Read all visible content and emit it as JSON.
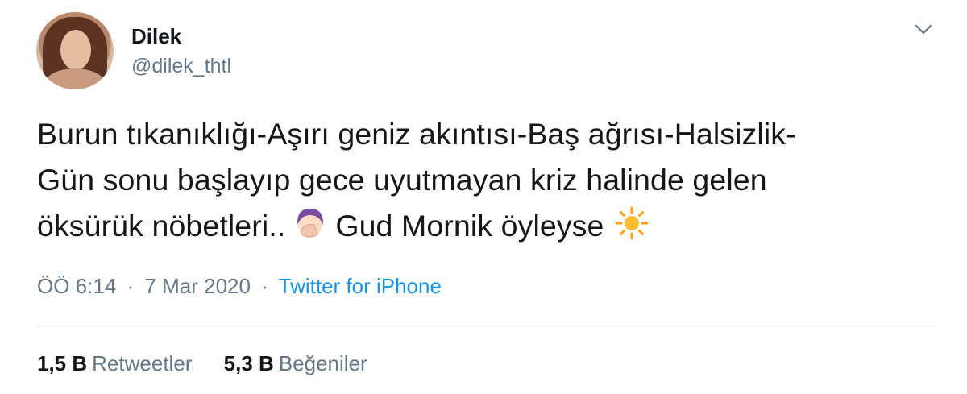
{
  "user": {
    "name": "Dilek",
    "handle": "@dilek_thtl"
  },
  "tweet": {
    "lines": [
      "Burun tıkanıklığı-Aşırı geniz akıntısı-Baş ağrısı-Halsizlik-",
      "Gün sonu başlayıp gece uyutmayan kriz halinde gelen",
      "öksürük nöbetleri.."
    ],
    "tail_text": "Gud Mornik öyleyse",
    "emojis": [
      "facepalm-emoji",
      "sun-emoji"
    ]
  },
  "meta": {
    "time": "ÖÖ 6:14",
    "separator": "·",
    "date": "7 Mar 2020",
    "source": "Twitter for iPhone"
  },
  "stats": {
    "retweets_count": "1,5 B",
    "retweets_label": "Retweetler",
    "likes_count": "5,3 B",
    "likes_label": "Beğeniler"
  },
  "colors": {
    "text": "#14171a",
    "secondary": "#657786",
    "link": "#1b95e0",
    "divider": "#e6ecf0"
  }
}
